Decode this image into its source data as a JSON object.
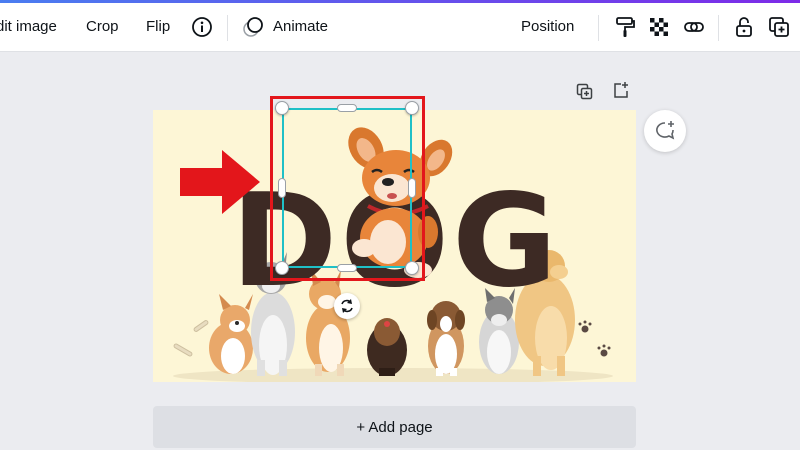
{
  "toolbar": {
    "edit_image_label": "dit image",
    "crop_label": "Crop",
    "flip_label": "Flip",
    "info_icon": "info-icon",
    "animate_label": "Animate",
    "position_label": "Position",
    "icons": [
      "paint-roller-icon",
      "transparency-icon",
      "link-icon",
      "unlock-icon",
      "copy-style-icon"
    ]
  },
  "canvas": {
    "design_title_text": "DOG",
    "top_icons": [
      "duplicate-page-icon",
      "add-page-icon"
    ],
    "comment_icon": "add-comment-icon",
    "rotate_icon": "rotate-icon",
    "add_page_label": "+ Add page"
  },
  "colors": {
    "selection": "#1fc0c7",
    "highlight": "#e3161b",
    "pointer_arrow": "#e3161b",
    "design_background": "#fdf6d6",
    "title_text": "#3d2a24"
  }
}
